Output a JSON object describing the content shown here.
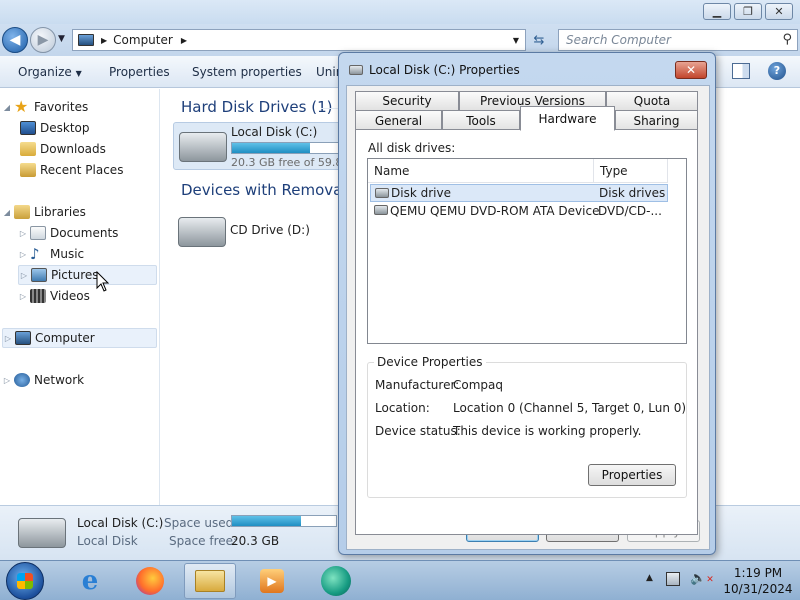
{
  "explorer": {
    "address_path": "Computer",
    "search_placeholder": "Search Computer",
    "toolbar": {
      "organize": "Organize",
      "properties": "Properties",
      "system_properties": "System properties",
      "uninstall_partial": "Unin"
    },
    "nav": {
      "favorites": "Favorites",
      "desktop": "Desktop",
      "downloads": "Downloads",
      "recent_places": "Recent Places",
      "libraries": "Libraries",
      "documents": "Documents",
      "music": "Music",
      "pictures": "Pictures",
      "videos": "Videos",
      "computer": "Computer",
      "network": "Network"
    },
    "content": {
      "hard_disk_group": "Hard Disk Drives (1)",
      "removable_group": "Devices with Removable",
      "drive_c_name": "Local Disk (C:)",
      "drive_c_free": "20.3 GB free of 59.8 G",
      "drive_c_usage_fraction": 0.66,
      "drive_d_name": "CD Drive (D:)"
    },
    "details": {
      "name": "Local Disk (C:)",
      "type": "Local Disk",
      "space_used_label": "Space used:",
      "space_used_fraction": 0.66,
      "space_free_label": "Space free:",
      "space_free_value": "20.3 GB"
    }
  },
  "dialog": {
    "title": "Local Disk (C:) Properties",
    "tabs_row1": [
      "Security",
      "Previous Versions",
      "Quota"
    ],
    "tabs_row2": [
      "General",
      "Tools",
      "Hardware",
      "Sharing"
    ],
    "active_tab": "Hardware",
    "all_disk_drives_label": "All disk drives:",
    "columns": {
      "name": "Name",
      "type": "Type"
    },
    "rows": [
      {
        "name": "Disk drive",
        "type": "Disk drives"
      },
      {
        "name": "QEMU QEMU DVD-ROM ATA Device",
        "type": "DVD/CD-..."
      }
    ],
    "device_properties": {
      "legend": "Device Properties",
      "manufacturer_label": "Manufacturer:",
      "manufacturer_value": "Compaq",
      "location_label": "Location:",
      "location_value": "Location 0 (Channel 5, Target 0, Lun 0)",
      "status_label": "Device status:",
      "status_value": "This device is working properly.",
      "properties_button": "Properties"
    },
    "buttons": {
      "ok": "OK",
      "cancel": "Cancel",
      "apply": "Apply"
    }
  },
  "taskbar": {
    "time": "1:19 PM",
    "date": "10/31/2024"
  }
}
